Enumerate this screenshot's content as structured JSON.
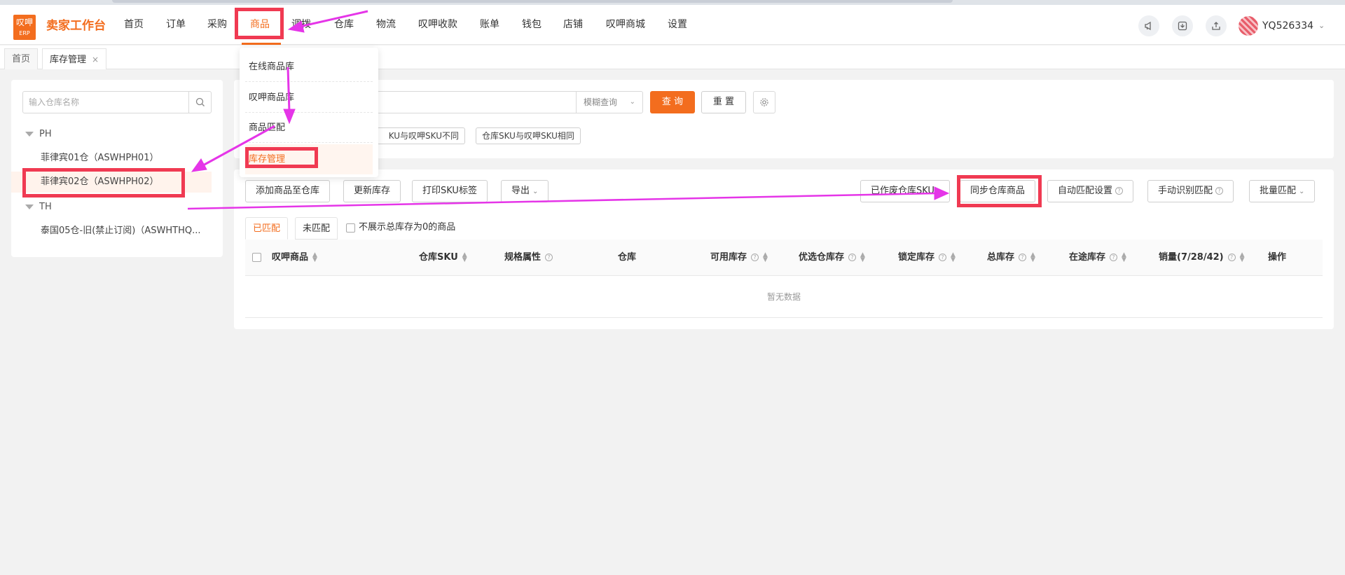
{
  "header": {
    "logo_top": "叹呷",
    "logo_bottom": "ERP",
    "brand": "卖家工作台",
    "nav": [
      "首页",
      "订单",
      "采购",
      "商品",
      "调拨",
      "仓库",
      "物流",
      "叹呷收款",
      "账单",
      "钱包",
      "店铺",
      "叹呷商城",
      "设置"
    ],
    "active_nav": "商品",
    "icons": [
      "megaphone-icon",
      "download-icon",
      "share-icon"
    ],
    "username": "YQ526334",
    "user_caret": "⌄"
  },
  "tabs": {
    "home": "首页",
    "current": "库存管理",
    "close": "×"
  },
  "dropdown": {
    "items": [
      "在线商品库",
      "叹呷商品库",
      "商品匹配",
      "库存管理"
    ]
  },
  "warehouse": {
    "search_placeholder": "输入仓库名称",
    "groups": [
      {
        "label": "PH",
        "items": [
          "菲律宾01仓（ASWHPH01）",
          "菲律宾02仓（ASWHPH02）"
        ]
      },
      {
        "label": "TH",
        "items": [
          "泰国05仓-旧(禁止订阅)（ASWHTHQ..."
        ]
      }
    ],
    "selected": "菲律宾02仓（ASWHPH02）"
  },
  "filter": {
    "mode": "模糊查询",
    "query_button": "查 询",
    "reset_button": "重 置",
    "chips": [
      "仓库SKU与叹呷SKU不同",
      "仓库SKU与叹呷SKU相同"
    ],
    "chip_partial": "KU与叹呷SKU不同"
  },
  "toolbar": {
    "add": "添加商品至仓库",
    "update": "更新库存",
    "print": "打印SKU标签",
    "export": "导出",
    "used": "已作废仓库SKU",
    "sync": "同步仓库商品",
    "auto": "自动匹配设置",
    "manual": "手动识别匹配",
    "batch": "批量匹配"
  },
  "match_tabs": {
    "matched": "已匹配",
    "unmatched": "未匹配",
    "hide_zero": "不展示总库存为0的商品"
  },
  "table": {
    "columns": [
      "叹呷商品",
      "仓库SKU",
      "规格属性",
      "仓库",
      "可用库存",
      "优选仓库存",
      "锁定库存",
      "总库存",
      "在途库存",
      "销量(7/28/42)",
      "操作"
    ],
    "empty": "暂无数据"
  },
  "colors": {
    "accent": "#f36d1e",
    "highlight": "#f03a52",
    "arrow": "#e535e8"
  }
}
